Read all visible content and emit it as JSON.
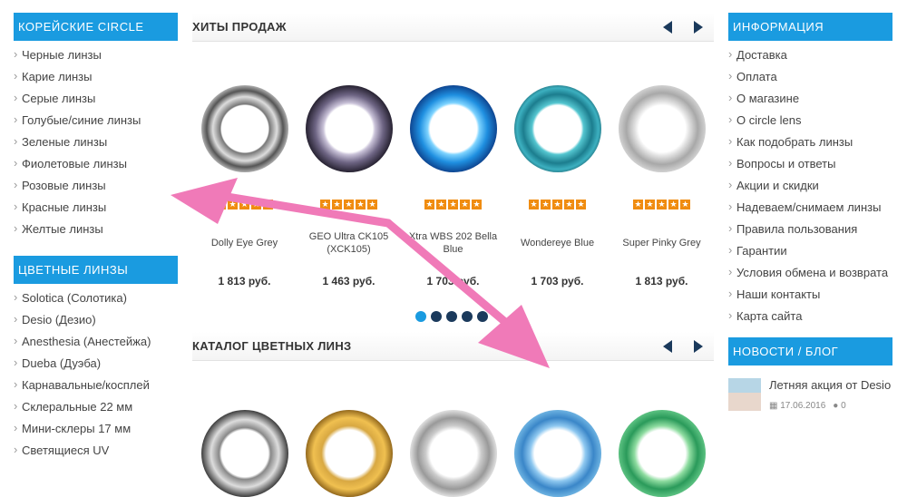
{
  "left": {
    "korean_head": "КОРЕЙСКИЕ CIRCLE LENS",
    "korean_items": [
      "Черные линзы",
      "Карие линзы",
      "Серые линзы",
      "Голубые/синие линзы",
      "Зеленые линзы",
      "Фиолетовые линзы",
      "Розовые линзы",
      "Красные линзы",
      "Желтые линзы"
    ],
    "colored_head": "ЦВЕТНЫЕ ЛИНЗЫ",
    "colored_items": [
      "Solotica (Солотика)",
      "Desio (Дезио)",
      "Anesthesia (Анестейжа)",
      "Dueba (Дуэба)",
      "Карнавальные/косплей",
      "Склеральные 22 мм",
      "Мини-склеры 17 мм",
      "Светящиеся UV"
    ]
  },
  "hits": {
    "title": "ХИТЫ ПРОДАЖ",
    "products": [
      {
        "name": "Dolly Eye Grey",
        "price": "1 813 руб.",
        "rating": 5
      },
      {
        "name": "GEO Ultra CK105 (XCK105)",
        "price": "1 463 руб.",
        "rating": 5
      },
      {
        "name": "Xtra WBS 202 Bella Blue",
        "price": "1 703 руб.",
        "rating": 5
      },
      {
        "name": "Wondereye Blue",
        "price": "1 703 руб.",
        "rating": 5
      },
      {
        "name": "Super Pinky Grey",
        "price": "1 813 руб.",
        "rating": 5
      }
    ],
    "pager_total": 5,
    "pager_active": 1
  },
  "catalog": {
    "title": "КАТАЛОГ ЦВЕТНЫХ ЛИНЗ"
  },
  "right": {
    "info_head": "ИНФОРМАЦИЯ",
    "info_items": [
      "Доставка",
      "Оплата",
      "О магазине",
      "О circle lens",
      "Как подобрать линзы",
      "Вопросы и ответы",
      "Акции и скидки",
      "Надеваем/снимаем линзы",
      "Правила пользования",
      "Гарантии",
      "Условия обмена и возврата",
      "Наши контакты",
      "Карта сайта"
    ],
    "news_head": "НОВОСТИ / БЛОГ",
    "news": {
      "title": "Летняя акция от Desio",
      "date": "17.06.2016",
      "comments": "0"
    }
  },
  "colors": {
    "accent": "#1a9be0",
    "nav_dark": "#1b3a5c",
    "star": "#f08c10",
    "annotation_arrow": "#f07ab8"
  }
}
